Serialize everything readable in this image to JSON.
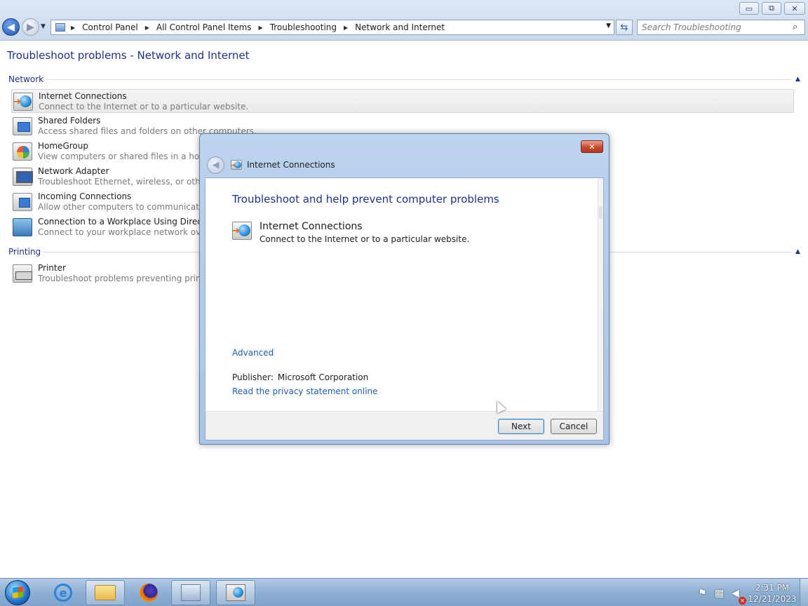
{
  "window": {
    "controls": {
      "minimize": "▭",
      "maximize": "⧉",
      "close": "✕"
    }
  },
  "navigation": {
    "back_icon": "arrow-left-icon",
    "forward_icon": "arrow-right-icon"
  },
  "address_bar": {
    "breadcrumbs": [
      "Control Panel",
      "All Control Panel Items",
      "Troubleshooting",
      "Network and Internet"
    ]
  },
  "search": {
    "placeholder": "Search Troubleshooting"
  },
  "page": {
    "title": "Troubleshoot problems - Network and Internet"
  },
  "groups": {
    "network": {
      "label": "Network",
      "items": [
        {
          "title": "Internet Connections",
          "desc": "Connect to the Internet or to a particular website."
        },
        {
          "title": "Shared Folders",
          "desc": "Access shared files and folders on other computers."
        },
        {
          "title": "HomeGroup",
          "desc": "View computers or shared files in a homegr"
        },
        {
          "title": "Network Adapter",
          "desc": "Troubleshoot Ethernet, wireless, or other ne"
        },
        {
          "title": "Incoming Connections",
          "desc": "Allow other computers to communicate wit"
        },
        {
          "title": "Connection to a Workplace Using DirectAcc",
          "desc": "Connect to your workplace network over th"
        }
      ]
    },
    "printing": {
      "label": "Printing",
      "items": [
        {
          "title": "Printer",
          "desc": "Troubleshoot problems preventing printing"
        }
      ]
    }
  },
  "dialog": {
    "title": "Internet Connections",
    "heading": "Troubleshoot and help prevent computer problems",
    "item_title": "Internet Connections",
    "item_desc": "Connect to the Internet or to a particular website.",
    "advanced_link": "Advanced",
    "publisher_label": "Publisher:",
    "publisher_value": "Microsoft Corporation",
    "privacy_link": "Read the privacy statement online",
    "next_label": "Next",
    "cancel_label": "Cancel",
    "close_glyph": "✕"
  },
  "taskbar": {
    "clock_time": "2:31 PM",
    "clock_date": "12/21/2023"
  },
  "colors": {
    "link": "#1f5fb0",
    "heading": "#1e3287",
    "taskbar": "#8fb0d4"
  }
}
